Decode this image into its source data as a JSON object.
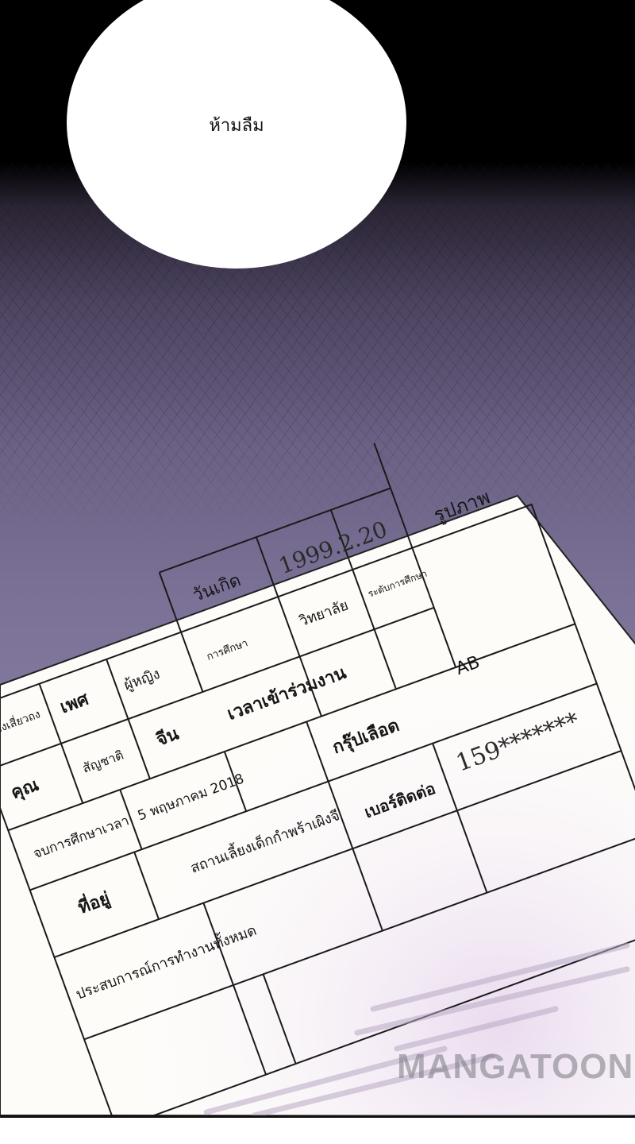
{
  "bubble": {
    "text": "ห้ามลืม"
  },
  "form": {
    "labels": {
      "gender": "เพศ",
      "birthdate": "วันเกิด",
      "photo": "รูปภาพ",
      "nationality": "สัญชาติ",
      "education": "การศึกษา",
      "education_level": "ระดับการศึกษา",
      "join_time": "เวลาเข้าร่วมงาน",
      "graduation": "จบการศึกษาเวลา",
      "blood_group": "กรุ๊ปเลือด",
      "address": "ที่อยู่",
      "contact_number": "เบอร์ติดต่อ",
      "experience": "ประสบการณ์การทำงานทั้งหมด"
    },
    "values": {
      "name_partial": "เจียงเสี่ยวถง",
      "title_partial": "คุณ",
      "gender": "ผู้หญิง",
      "birthdate": "1999.2.20",
      "nationality": "จีน",
      "education": "วิทยาลัย",
      "graduation_date": "5 พฤษภาคม 2018",
      "blood_group": "AB",
      "address": "สถานเลี้ยงเด็กกำพร้าเผิงจี",
      "contact_number": "159*******"
    }
  },
  "watermark": {
    "text": "MANGATOON"
  }
}
